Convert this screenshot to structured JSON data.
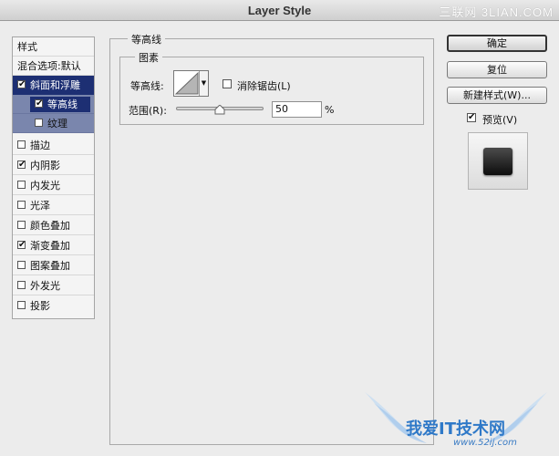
{
  "window": {
    "title": "Layer Style",
    "watermark_top": "三联网 3LIAN.COM"
  },
  "styles_list": {
    "header": "样式",
    "blend_options": "混合选项:默认",
    "items": [
      {
        "label": "斜面和浮雕",
        "checked": true,
        "selected": true
      },
      {
        "label": "等高线",
        "checked": true,
        "selected": true,
        "sub": true
      },
      {
        "label": "纹理",
        "checked": false,
        "sub": true
      },
      {
        "label": "描边",
        "checked": false
      },
      {
        "label": "内阴影",
        "checked": true
      },
      {
        "label": "内发光",
        "checked": false
      },
      {
        "label": "光泽",
        "checked": false
      },
      {
        "label": "颜色叠加",
        "checked": false
      },
      {
        "label": "渐变叠加",
        "checked": true
      },
      {
        "label": "图案叠加",
        "checked": false
      },
      {
        "label": "外发光",
        "checked": false
      },
      {
        "label": "投影",
        "checked": false
      }
    ]
  },
  "panel": {
    "title": "等高线",
    "group_title": "图素",
    "contour_label": "等高线:",
    "antialias_label": "消除锯齿(L)",
    "antialias_checked": false,
    "range_label": "范围(R):",
    "range_value": "50",
    "range_unit": "%",
    "range_fraction": 0.5
  },
  "buttons": {
    "ok": "确定",
    "reset": "复位",
    "new_style": "新建样式(W)...",
    "preview_label": "预览(V)",
    "preview_checked": true
  },
  "watermark_bottom": {
    "text": "我爱IT技术网",
    "url": "www.52ij.com"
  },
  "colors": {
    "selection": "#1d2f73",
    "sub_selection": "#7a86ad",
    "watermark": "#2f79c8"
  }
}
